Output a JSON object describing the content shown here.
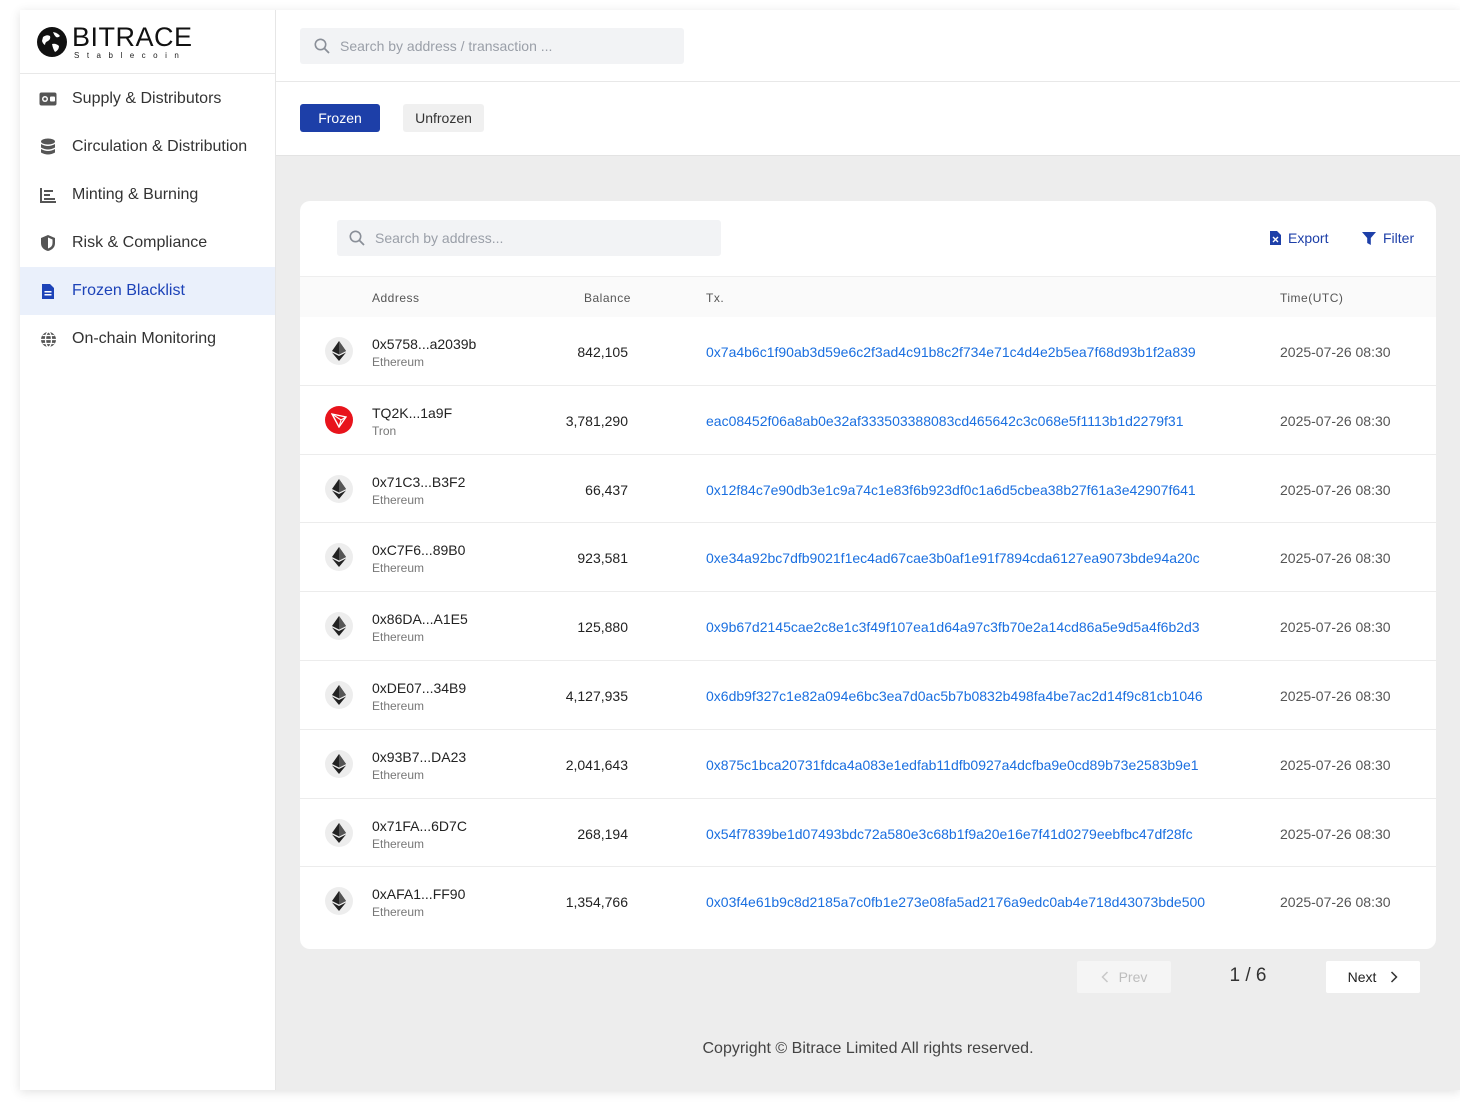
{
  "brand": {
    "name": "BITRACE",
    "sub": "Stablecoin"
  },
  "top_search": {
    "placeholder": "Search by address / transaction ..."
  },
  "sidebar": {
    "items": [
      {
        "label": "Supply  & Distributors",
        "icon": "wallet-icon"
      },
      {
        "label": "Circulation & Distribution",
        "icon": "database-icon"
      },
      {
        "label": "Minting & Burning",
        "icon": "bar-chart-icon"
      },
      {
        "label": "Risk & Compliance",
        "icon": "shield-icon"
      },
      {
        "label": "Frozen Blacklist",
        "icon": "document-icon",
        "active": true
      },
      {
        "label": "On-chain Monitoring",
        "icon": "globe-icon"
      }
    ]
  },
  "tabs": {
    "frozen": "Frozen",
    "unfrozen": "Unfrozen"
  },
  "table": {
    "search_placeholder": "Search by address...",
    "export_label": "Export",
    "filter_label": "Filter",
    "headers": {
      "address": "Address",
      "balance": "Balance",
      "tx": "Tx.",
      "time": "Time(UTC)"
    },
    "rows": [
      {
        "address": "0x5758...a2039b",
        "chain": "Ethereum",
        "balance": "842,105",
        "tx": "0x7a4b6c1f90ab3d59e6c2f3ad4c91b8c2f734e71c4d4e2b5ea7f68d93b1f2a839",
        "time": "2025-07-26 08:30"
      },
      {
        "address": "TQ2K...1a9F",
        "chain": "Tron",
        "balance": "3,781,290",
        "tx": "eac08452f06a8ab0e32af333503388083cd465642c3c068e5f1113b1d2279f31",
        "time": "2025-07-26 08:30"
      },
      {
        "address": "0x71C3...B3F2",
        "chain": "Ethereum",
        "balance": "66,437",
        "tx": "0x12f84c7e90db3e1c9a74c1e83f6b923df0c1a6d5cbea38b27f61a3e42907f641",
        "time": "2025-07-26 08:30"
      },
      {
        "address": "0xC7F6...89B0",
        "chain": "Ethereum",
        "balance": "923,581",
        "tx": "0xe34a92bc7dfb9021f1ec4ad67cae3b0af1e91f7894cda6127ea9073bde94a20c",
        "time": "2025-07-26 08:30"
      },
      {
        "address": "0x86DA...A1E5",
        "chain": "Ethereum",
        "balance": "125,880",
        "tx": "0x9b67d2145cae2c8e1c3f49f107ea1d64a97c3fb70e2a14cd86a5e9d5a4f6b2d3",
        "time": "2025-07-26 08:30"
      },
      {
        "address": "0xDE07...34B9",
        "chain": "Ethereum",
        "balance": "4,127,935",
        "tx": "0x6db9f327c1e82a094e6bc3ea7d0ac5b7b0832b498fa4be7ac2d14f9c81cb1046",
        "time": "2025-07-26 08:30"
      },
      {
        "address": "0x93B7...DA23",
        "chain": "Ethereum",
        "balance": "2,041,643",
        "tx": "0x875c1bca20731fdca4a083e1edfab11dfb0927a4dcfba9e0cd89b73e2583b9e1",
        "time": "2025-07-26 08:30"
      },
      {
        "address": "0x71FA...6D7C",
        "chain": "Ethereum",
        "balance": "268,194",
        "tx": "0x54f7839be1d07493bdc72a580e3c68b1f9a20e16e7f41d0279eebfbc47df28fc",
        "time": "2025-07-26 08:30"
      },
      {
        "address": "0xAFA1...FF90",
        "chain": "Ethereum",
        "balance": "1,354,766",
        "tx": "0x03f4e61b9c8d2185a7c0fb1e273e08fa5ad2176a9edc0ab4e718d43073bde500",
        "time": "2025-07-26 08:30"
      }
    ]
  },
  "pager": {
    "prev": "Prev",
    "next": "Next",
    "text": "1 / 6"
  },
  "footer": {
    "copyright": "Copyright © Bitrace Limited All rights reserved."
  },
  "colors": {
    "primary": "#1d3fa8",
    "link": "#1a6fe0",
    "tron": "#e8141c"
  }
}
